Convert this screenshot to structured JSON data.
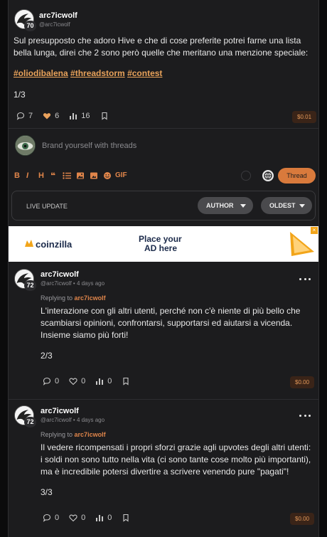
{
  "main_post": {
    "username": "arc7icwolf",
    "handle": "@arc7icwolf",
    "reputation": "70",
    "body": "Sul presupposto che adoro Hive e che di cose preferite potrei farne una lista bella lunga, direi che 2 sono però quelle che meritano una menzione speciale:",
    "tags": [
      "#oliodibalena",
      "#threadstorm",
      "#contest"
    ],
    "page": "1/3",
    "comments": "7",
    "likes": "6",
    "views": "16",
    "payout": "$0.01"
  },
  "composer": {
    "placeholder": "Brand yourself with threads",
    "gif_label": "GIF",
    "thread_button": "Thread"
  },
  "filters": {
    "live_update": "LIVE UPDATE",
    "author": "AUTHOR",
    "oldest": "OLDEST"
  },
  "ad": {
    "brand": "coinzilla",
    "line1": "Place your",
    "line2": "AD here"
  },
  "replies": [
    {
      "username": "arc7icwolf",
      "handle": "@arc7icwolf",
      "time": "4 days ago",
      "reputation": "72",
      "replying_prefix": "Replying to",
      "replying_to": "arc7icwolf",
      "body": "L'interazione con gli altri utenti, perché non c'è niente di più bello che scambiarsi opinioni, confrontarsi, supportarsi ed aiutarsi a vicenda. Insieme siamo più forti!",
      "page": "2/3",
      "comments": "0",
      "likes": "0",
      "views": "0",
      "payout": "$0.00"
    },
    {
      "username": "arc7icwolf",
      "handle": "@arc7icwolf",
      "time": "4 days ago",
      "reputation": "72",
      "replying_prefix": "Replying to",
      "replying_to": "arc7icwolf",
      "body": "Il vedere ricompensati i propri sforzi grazie agli upvotes degli altri utenti: i soldi non sono tutto nella vita (ci sono tante cose molto più importanti), ma è incredibile potersi divertire a scrivere venendo pure \"pagati\"!",
      "page": "3/3",
      "comments": "0",
      "likes": "0",
      "views": "0",
      "payout": "$0.00"
    }
  ],
  "colors": {
    "accent": "#e0854a",
    "background": "#1c1c1e",
    "pill": "#4a4a4d",
    "thread_button": "#d97a3c"
  }
}
